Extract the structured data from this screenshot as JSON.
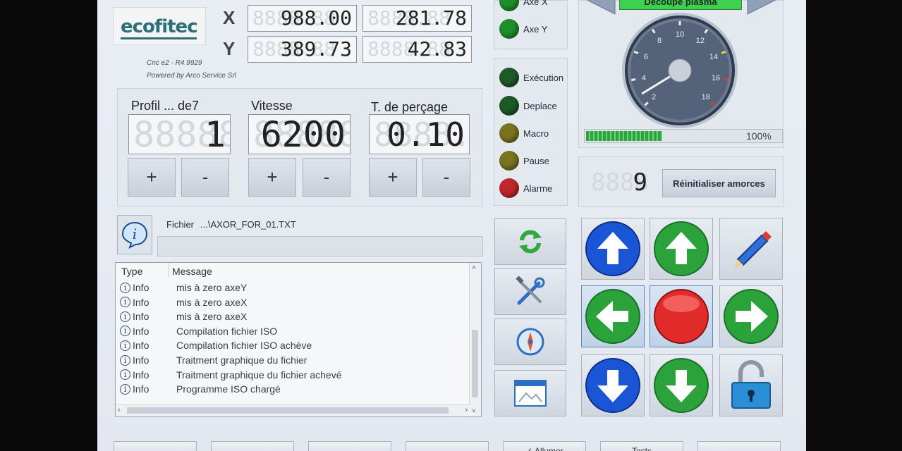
{
  "logo": {
    "text": "ecofitec"
  },
  "version": {
    "line1": "Cnc e2 - R4.9929",
    "line2": "Powered by Arco Service Srl"
  },
  "coords": {
    "x_label": "X",
    "y_label": "Y",
    "x_machine": "988.00",
    "x_work": "281.78",
    "y_machine": "389.73",
    "y_work": "42.83"
  },
  "params": {
    "profil": {
      "label": "Profil ... de7",
      "value": "1"
    },
    "vitesse": {
      "label": "Vitesse",
      "value": "6200"
    },
    "percage": {
      "label": "T. de perçage",
      "value": "0.10"
    },
    "plus": "+",
    "minus": "-"
  },
  "axes_status": [
    {
      "label": "Axe X",
      "color": "#1f8f2a"
    },
    {
      "label": "Axe Y",
      "color": "#1f8f2a"
    }
  ],
  "states": [
    {
      "label": "Exécution",
      "color": "#1e5a28"
    },
    {
      "label": "Deplace",
      "color": "#1e5a28"
    },
    {
      "label": "Macro",
      "color": "#7a7420"
    },
    {
      "label": "Pause",
      "color": "#7a7420"
    },
    {
      "label": "Alarme",
      "color": "#c0272d"
    }
  ],
  "process": {
    "label": "Découpe plasma",
    "progress_percent": 100,
    "progress_label": "100%",
    "gauge_fraction": 0.05
  },
  "gauge_ticks": [
    "2",
    "4",
    "6",
    "8",
    "10",
    "12",
    "14",
    "16",
    "18"
  ],
  "counter": {
    "value": "9",
    "reset_label": "Réinitialiser amorces"
  },
  "file": {
    "label": "Fichier",
    "name": "...\\AXOR_FOR_01.TXT"
  },
  "log": {
    "col_type": "Type",
    "col_message": "Message",
    "rows": [
      {
        "type": "Info",
        "message": "mis à zero axeY"
      },
      {
        "type": "Info",
        "message": "mis à zero axeX"
      },
      {
        "type": "Info",
        "message": "mis à zero axeX"
      },
      {
        "type": "Info",
        "message": "Compilation fichier ISO"
      },
      {
        "type": "Info",
        "message": "Compilation fichier ISO achève"
      },
      {
        "type": "Info",
        "message": "Traitment graphique du fichier"
      },
      {
        "type": "Info",
        "message": "Traitment graphique du fichier achevé"
      },
      {
        "type": "Info",
        "message": "Programme ISO chargé"
      }
    ]
  },
  "bottom": {
    "b5": "✓ Allumer",
    "b6": "Tests"
  }
}
